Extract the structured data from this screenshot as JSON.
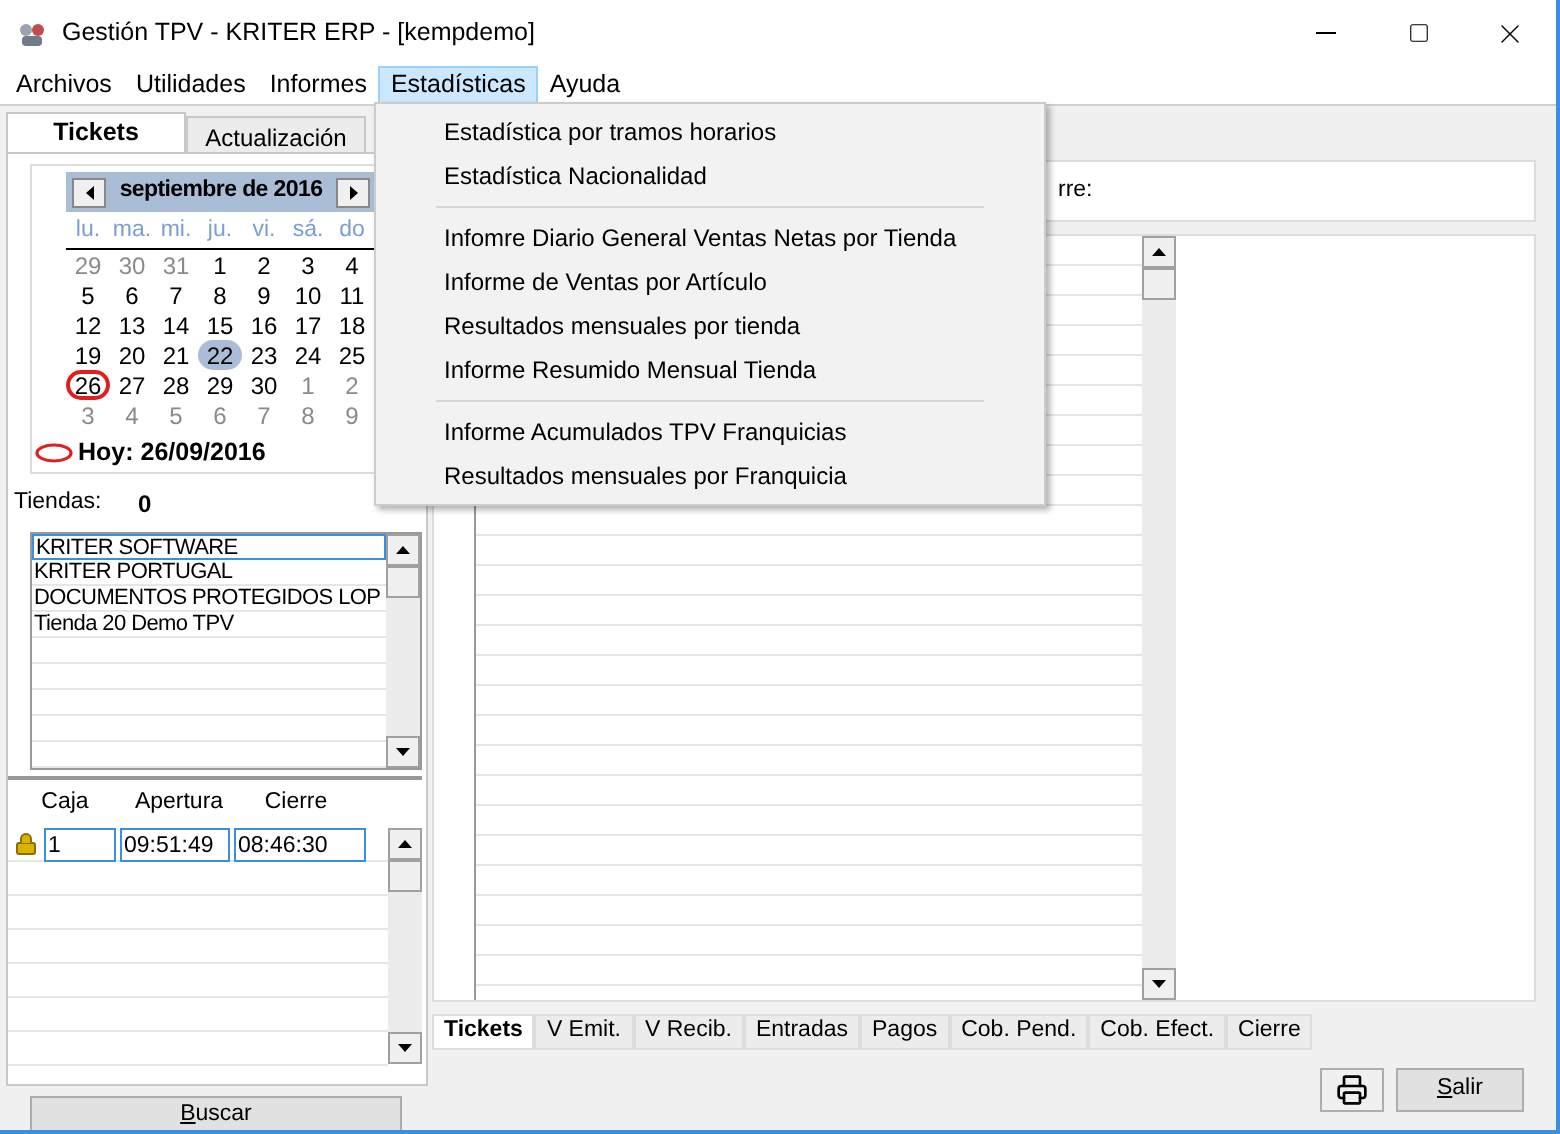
{
  "window": {
    "title": "Gestión TPV - KRITER ERP - [kempdemo]"
  },
  "menu": [
    {
      "label": "Archivos",
      "selected": false
    },
    {
      "label": "Utilidades",
      "selected": false
    },
    {
      "label": "Informes",
      "selected": false
    },
    {
      "label": "Estadísticas",
      "selected": true
    },
    {
      "label": "Ayuda",
      "selected": false
    }
  ],
  "dropdown": {
    "groups": [
      [
        "Estadística por tramos horarios",
        "Estadística Nacionalidad"
      ],
      [
        "Infomre Diario General Ventas Netas por Tienda",
        "Informe de Ventas por Artículo",
        "Resultados mensuales por tienda",
        "Informe Resumido Mensual Tienda"
      ],
      [
        "Informe Acumulados TPV Franquicias",
        "Resultados mensuales por Franquicia"
      ]
    ]
  },
  "left_tabs": [
    {
      "label": "Tickets",
      "selected": true
    },
    {
      "label": "Actualización",
      "selected": false
    }
  ],
  "calendar": {
    "month": "septiembre de 2016",
    "weekdays": [
      "lu.",
      "ma.",
      "mi.",
      "ju.",
      "vi.",
      "sá.",
      "do"
    ],
    "weeks": [
      [
        {
          "day": "29",
          "kind": "other"
        },
        {
          "day": "30",
          "kind": "other"
        },
        {
          "day": "31",
          "kind": "other"
        },
        {
          "day": "1",
          "kind": "current"
        },
        {
          "day": "2",
          "kind": "current"
        },
        {
          "day": "3",
          "kind": "current"
        },
        {
          "day": "4",
          "kind": "current"
        }
      ],
      [
        {
          "day": "5",
          "kind": "current"
        },
        {
          "day": "6",
          "kind": "current"
        },
        {
          "day": "7",
          "kind": "current"
        },
        {
          "day": "8",
          "kind": "current"
        },
        {
          "day": "9",
          "kind": "current"
        },
        {
          "day": "10",
          "kind": "current"
        },
        {
          "day": "11",
          "kind": "current"
        }
      ],
      [
        {
          "day": "12",
          "kind": "current"
        },
        {
          "day": "13",
          "kind": "current"
        },
        {
          "day": "14",
          "kind": "current"
        },
        {
          "day": "15",
          "kind": "current"
        },
        {
          "day": "16",
          "kind": "current"
        },
        {
          "day": "17",
          "kind": "current"
        },
        {
          "day": "18",
          "kind": "current"
        }
      ],
      [
        {
          "day": "19",
          "kind": "current"
        },
        {
          "day": "20",
          "kind": "current"
        },
        {
          "day": "21",
          "kind": "current"
        },
        {
          "day": "22",
          "kind": "selected"
        },
        {
          "day": "23",
          "kind": "current"
        },
        {
          "day": "24",
          "kind": "current"
        },
        {
          "day": "25",
          "kind": "current"
        }
      ],
      [
        {
          "day": "26",
          "kind": "today"
        },
        {
          "day": "27",
          "kind": "current"
        },
        {
          "day": "28",
          "kind": "current"
        },
        {
          "day": "29",
          "kind": "current"
        },
        {
          "day": "30",
          "kind": "current"
        },
        {
          "day": "1",
          "kind": "other"
        },
        {
          "day": "2",
          "kind": "other"
        }
      ],
      [
        {
          "day": "3",
          "kind": "other"
        },
        {
          "day": "4",
          "kind": "other"
        },
        {
          "day": "5",
          "kind": "other"
        },
        {
          "day": "6",
          "kind": "other"
        },
        {
          "day": "7",
          "kind": "other"
        },
        {
          "day": "8",
          "kind": "other"
        },
        {
          "day": "9",
          "kind": "other"
        }
      ]
    ],
    "today": "Hoy: 26/09/2016"
  },
  "stores": {
    "label": "Tiendas:",
    "count": "0",
    "items": [
      {
        "name": "KRITER SOFTWARE",
        "selected": true
      },
      {
        "name": "KRITER PORTUGAL",
        "selected": false
      },
      {
        "name": "DOCUMENTOS PROTEGIDOS LOP",
        "selected": false
      },
      {
        "name": "Tienda 20 Demo TPV",
        "selected": false
      }
    ]
  },
  "registers": {
    "columns": [
      "Caja",
      "Apertura",
      "Cierre"
    ],
    "rows": [
      {
        "locked": true,
        "caja": "1",
        "apertura": "09:51:49",
        "cierre": "08:46:30"
      }
    ]
  },
  "search_button": "Buscar",
  "top_panel": {
    "label": "rre:"
  },
  "bottom_tabs": [
    {
      "label": "Tickets",
      "selected": true
    },
    {
      "label": "V Emit.",
      "selected": false
    },
    {
      "label": "V Recib.",
      "selected": false
    },
    {
      "label": "Entradas",
      "selected": false
    },
    {
      "label": "Pagos",
      "selected": false
    },
    {
      "label": "Cob. Pend.",
      "selected": false
    },
    {
      "label": "Cob. Efect.",
      "selected": false
    },
    {
      "label": "Cierre",
      "selected": false
    }
  ],
  "exit_button": "Salir"
}
